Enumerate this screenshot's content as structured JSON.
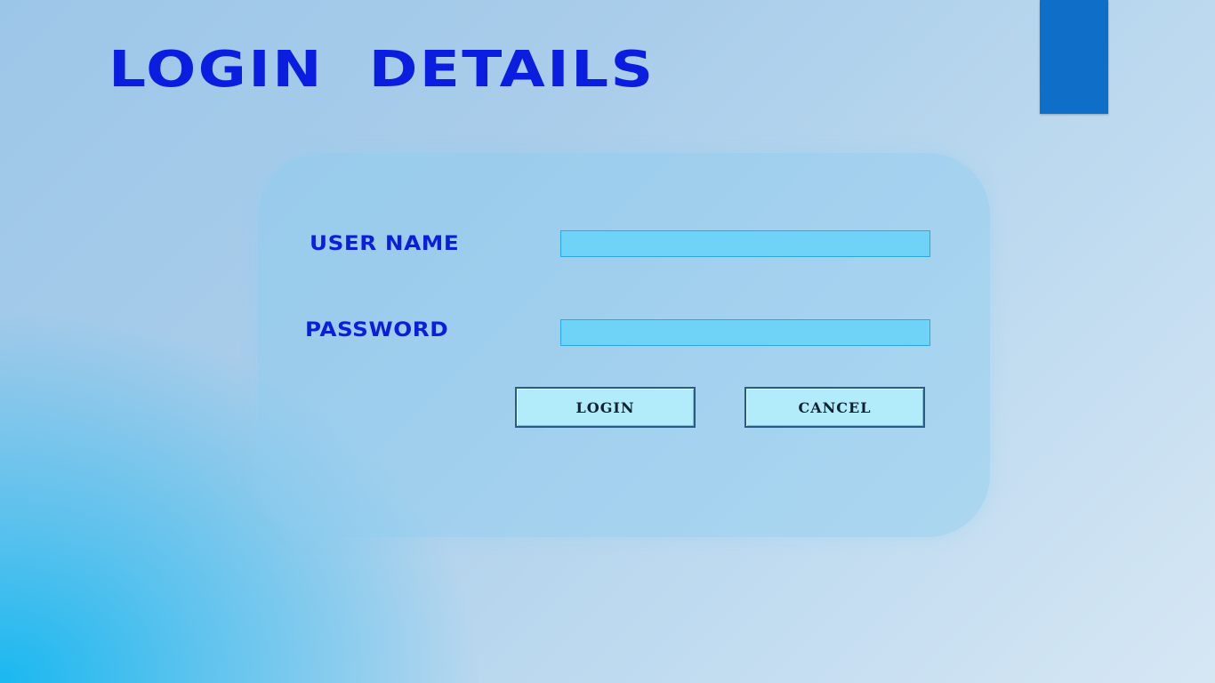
{
  "header": {
    "title": "LOGIN  DETAILS"
  },
  "form": {
    "username_label": "USER NAME",
    "username_value": "",
    "password_label": "PASSWORD",
    "password_value": "",
    "login_label": "LOGIN",
    "cancel_label": "CANCEL"
  },
  "colors": {
    "title_text": "#0b1ee0",
    "corner_block": "#0f6ec8",
    "input_fill": "#6fd2f7",
    "button_fill": "#b2ecfa"
  }
}
